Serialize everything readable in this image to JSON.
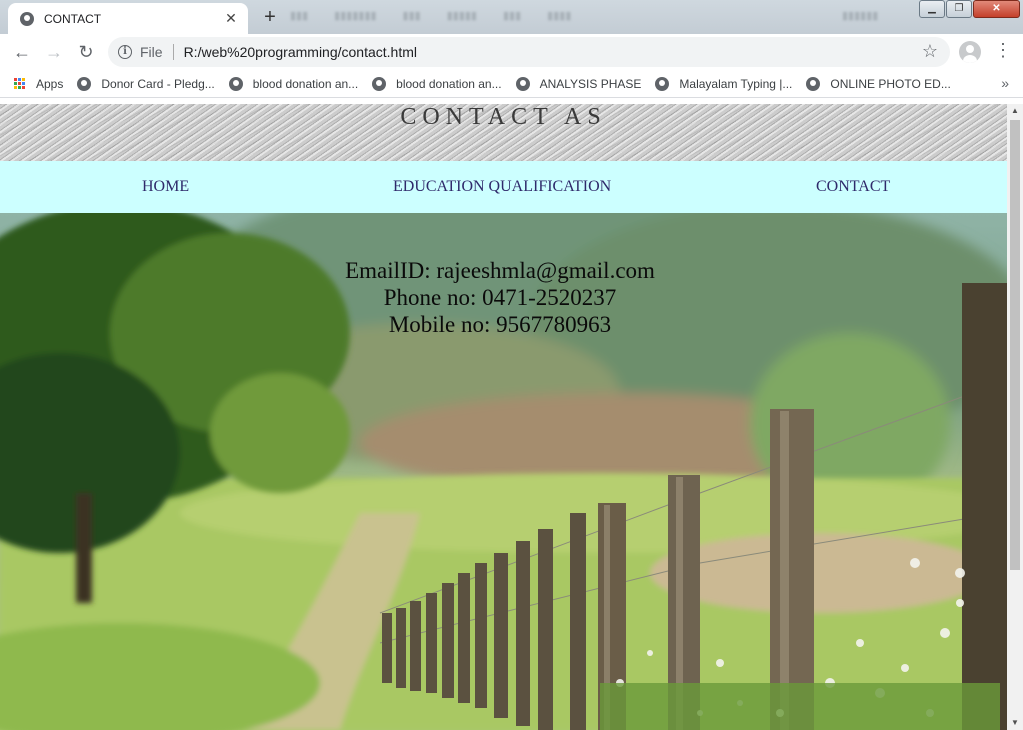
{
  "browser": {
    "tab_title": "CONTACT",
    "tab_close": "✕",
    "new_tab": "+",
    "back": "←",
    "forward": "→",
    "reload": "↻",
    "info": "i",
    "url_scheme": "File",
    "url": "R:/web%20programming/contact.html",
    "star": "☆",
    "menu": "⋮",
    "window_controls": {
      "minimize": "▁",
      "maximize": "❐",
      "close": "✕"
    },
    "bookmarks": [
      {
        "label": "Apps",
        "icon": "apps-grid-icon"
      },
      {
        "label": "Donor Card - Pledg...",
        "icon": "globe-icon"
      },
      {
        "label": "blood donation an...",
        "icon": "globe-icon"
      },
      {
        "label": "blood donation an...",
        "icon": "globe-icon"
      },
      {
        "label": "ANALYSIS PHASE",
        "icon": "globe-icon"
      },
      {
        "label": "Malayalam Typing |...",
        "icon": "globe-icon"
      },
      {
        "label": "ONLINE PHOTO ED...",
        "icon": "globe-icon"
      }
    ],
    "bookmarks_more": "»"
  },
  "page": {
    "title": "CONTACT AS",
    "nav": {
      "home": "HOME",
      "education": "EDUCATION QUALIFICATION",
      "contact": "CONTACT"
    },
    "contact": {
      "email": "EmailID: rajeeshmla@gmail.com",
      "phone": "Phone no: 0471-2520237",
      "mobile": "Mobile no: 9567780963"
    }
  },
  "colors": {
    "navbar_bg": "#ccffff",
    "nav_link": "#2f2a6b",
    "title_text": "#3a3a3a"
  }
}
